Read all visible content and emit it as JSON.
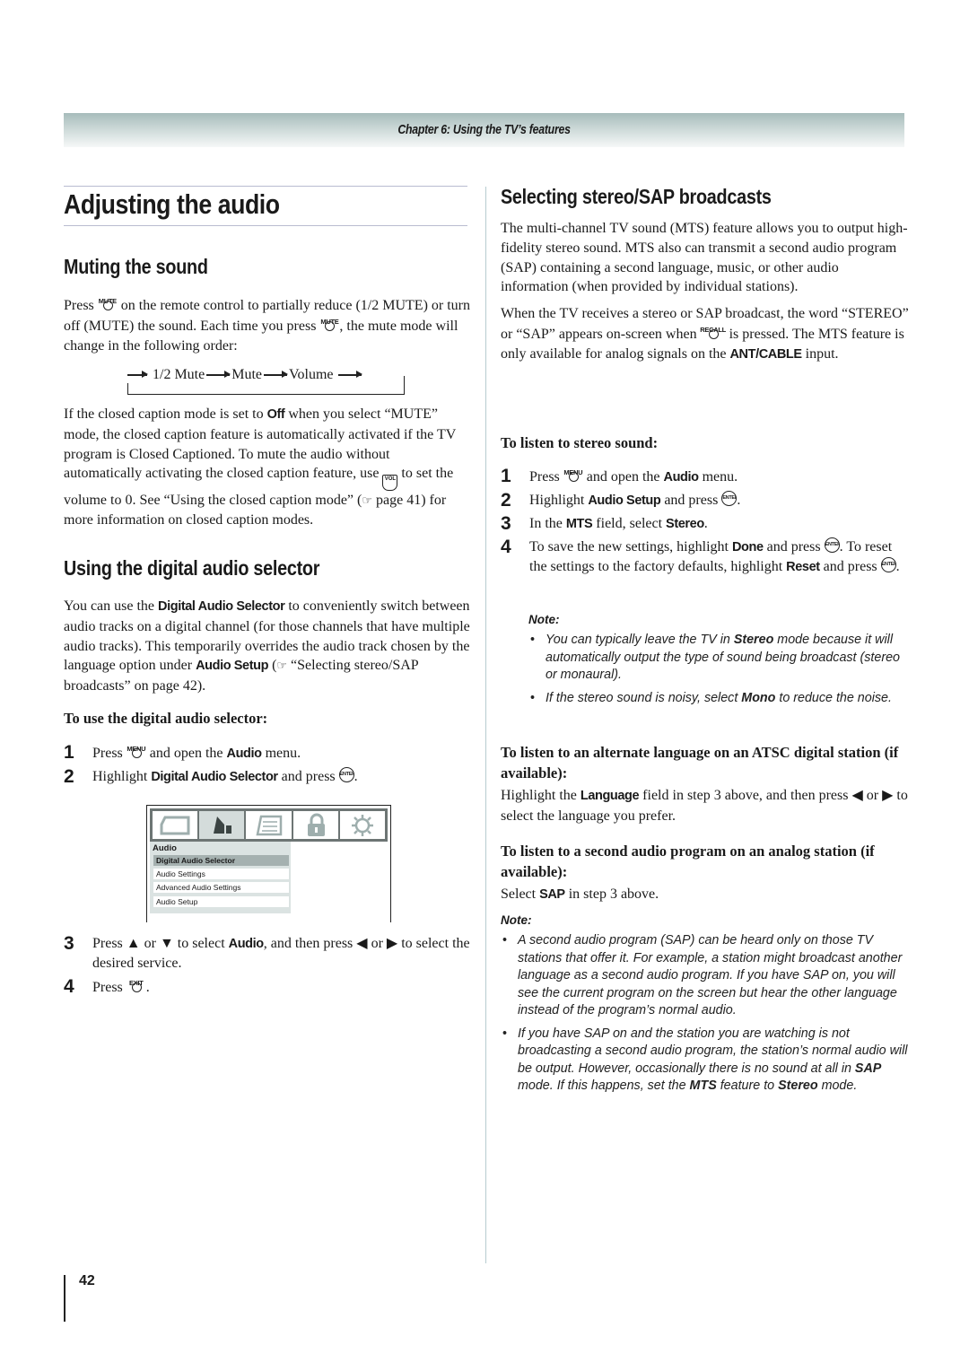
{
  "header": {
    "chapter": "Chapter 6: Using the TV’s features"
  },
  "left": {
    "title": "Adjusting the audio",
    "muting": {
      "heading": "Muting the sound",
      "p1": {
        "a": "Press ",
        "key": "MUTE",
        "b": " on the remote control to partially reduce (1/2 MUTE) or turn off (MUTE) the sound. Each time you press ",
        "key2": "MUTE",
        "c": ", the mute mode will change in the following order:"
      },
      "order": [
        "1/2 Mute",
        "Mute",
        "Volume"
      ],
      "p2": {
        "a": "If the closed caption mode is set to ",
        "off": "Off",
        "b": " when you select “MUTE” mode, the closed caption feature is automatically activated if the TV program is Closed Captioned. To mute the audio without automatically activating the closed caption feature, use ",
        "vol": "VOL",
        "c": " to set the volume to 0. See “Using the closed caption mode” (",
        "ref": "☞",
        "d": " page 41) for more information on closed caption modes."
      }
    },
    "selector": {
      "heading": "Using the digital audio selector",
      "p1": {
        "a": "You can use the ",
        "b1": "Digital Audio Selector",
        "b": " to conveniently switch between audio tracks on a digital channel (for those channels that have multiple audio tracks). This temporarily overrides the audio track chosen by the language option under ",
        "b2": "Audio Setup",
        "c": " (",
        "ref": "☞",
        "d": " “Selecting stereo/SAP broadcasts” on page 42)."
      },
      "subheading": "To use the digital audio selector:",
      "steps": [
        {
          "n": "1",
          "a": "Press ",
          "key": "MENU",
          "b": " and open the ",
          "bold": "Audio",
          "c": " menu."
        },
        {
          "n": "2",
          "a": "Highlight ",
          "bold": "Digital Audio Selector",
          "b": " and press ",
          "enter": "ENTER",
          "c": "."
        },
        {
          "n": "3",
          "a": "Press ▲ or ▼ to select ",
          "bold": "Audio",
          "b": ", and then press ◀ or ▶ to select the desired service."
        },
        {
          "n": "4",
          "a": "Press ",
          "key": "EXIT",
          "b": "."
        }
      ],
      "menu": {
        "heading": "Audio",
        "items": [
          "Digital Audio Selector",
          "Audio Settings",
          "Advanced Audio Settings",
          "Audio Setup"
        ],
        "selected": "Digital Audio Selector",
        "icons": [
          "picture-icon",
          "audio-speaker-icon",
          "preferences-icon",
          "lock-icon",
          "setup-gear-icon"
        ]
      }
    },
    "page_number": "42"
  },
  "right": {
    "heading": "Selecting stereo/SAP broadcasts",
    "p1": "The multi-channel TV sound (MTS) feature allows you to output high-fidelity stereo sound. MTS also can transmit a second audio program (SAP) containing a second language, music, or other audio information (when provided by individual stations).",
    "p2": {
      "a": "When the TV receives a stereo or SAP broadcast, the word “STEREO” or “SAP” appears on-screen when ",
      "key": "RECALL",
      "b": " is pressed. The MTS feature is only available for analog signals on the ",
      "bold": "ANT/CABLE",
      "c": " input."
    },
    "stereo": {
      "subheading": "To listen to stereo sound:",
      "steps": [
        {
          "n": "1",
          "a": "Press ",
          "key": "MENU",
          "b": " and open the ",
          "bold": "Audio",
          "c": " menu."
        },
        {
          "n": "2",
          "a": "Highlight ",
          "bold": "Audio Setup",
          "b": " and press ",
          "enter": "ENTER",
          "c": "."
        },
        {
          "n": "3",
          "a": "In the ",
          "bold": "MTS",
          "b": " field, select ",
          "bold2": "Stereo",
          "c": "."
        },
        {
          "n": "4",
          "a": "To save the new settings, highlight ",
          "bold": "Done",
          "b": " and press ",
          "enter": "ENTER",
          "c": ". To reset the settings to the factory defaults, highlight ",
          "bold2": "Reset",
          "d": " and press ",
          "e": "."
        }
      ],
      "note_title": "Note:",
      "notes": [
        {
          "a": "You can typically leave the TV in ",
          "bold": "Stereo",
          "b": " mode because it will automatically output the type of sound being broadcast (stereo or monaural)."
        },
        {
          "a": "If the stereo sound is noisy, select ",
          "bold": "Mono",
          "b": " to reduce the noise."
        }
      ]
    },
    "atsc": {
      "subheading": "To listen to an alternate language on an ATSC digital station (if available):",
      "a": "Highlight the ",
      "bold": "Language",
      "b": " field in step 3 above, and then press ◀ or ▶ to select the language you prefer."
    },
    "sap": {
      "subheading": "To listen to a second audio program on an analog station (if available):",
      "a": "Select ",
      "bold": "SAP",
      "b": " in step 3 above.",
      "note_title": "Note:",
      "notes": [
        {
          "a": "A second audio program (SAP) can be heard only on those TV stations that offer it. For example, a station might broadcast another language as a second audio program. If you have SAP on, you will see the current program on the screen but hear the other language instead of the program’s normal audio."
        },
        {
          "a": "If you have SAP on and the station you are watching is not broadcasting a second audio program, the station’s normal audio will be output. However, occasionally there is no sound at all in ",
          "bold": "SAP",
          "b": " mode. If this happens, set the ",
          "bold2": "MTS",
          "c": " feature to ",
          "bold3": "Stereo",
          "d": " mode."
        }
      ]
    }
  }
}
